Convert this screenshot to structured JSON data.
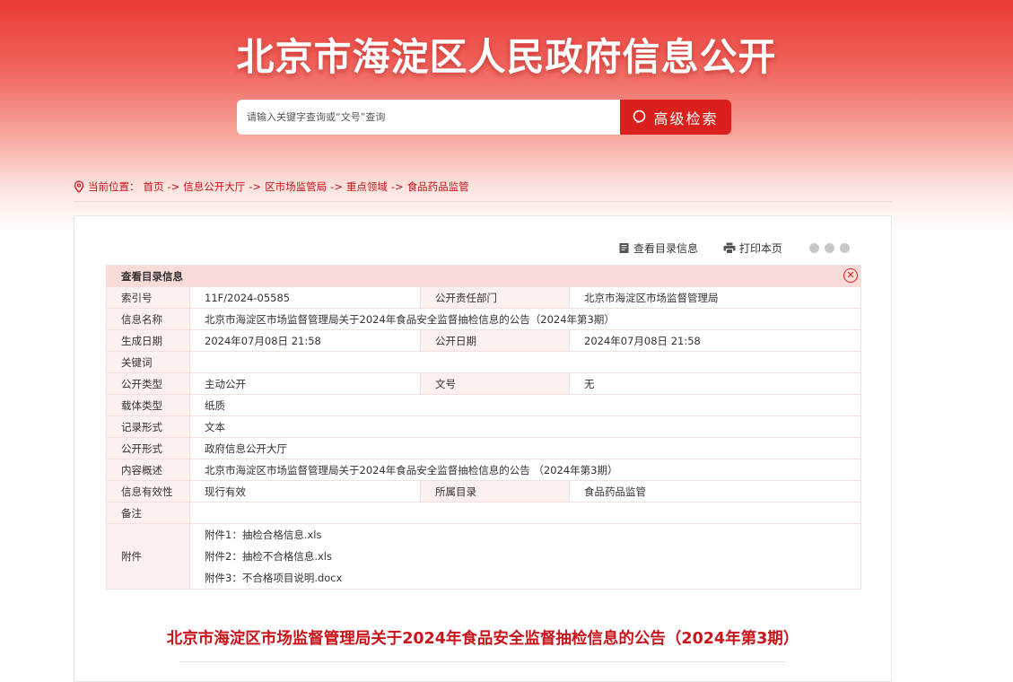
{
  "header": {
    "site_title": "北京市海淀区人民政府信息公开",
    "search_placeholder": "请输入关键字查询或“文号”查询",
    "search_button": "高级检索"
  },
  "breadcrumb": {
    "prefix": "当前位置：",
    "items": [
      "首页",
      "信息公开大厅",
      "区市场监管局",
      "重点领域",
      "食品药品监管"
    ],
    "separator": "->"
  },
  "tools": {
    "view_catalog": "查看目录信息",
    "print": "打印本页"
  },
  "catalog": {
    "title": "查看目录信息",
    "index_label": "索引号",
    "index_value": "11F/2024-05585",
    "dept_label": "公开责任部门",
    "dept_value": "北京市海淀区市场监督管理局",
    "name_label": "信息名称",
    "name_value": "北京市海淀区市场监督管理局关于2024年食品安全监督抽检信息的公告（2024年第3期）",
    "created_label": "生成日期",
    "created_value": "2024年07月08日 21:58",
    "published_label": "公开日期",
    "published_value": "2024年07月08日 21:58",
    "keywords_label": "关键词",
    "keywords_value": "",
    "open_type_label": "公开类型",
    "open_type_value": "主动公开",
    "doc_no_label": "文号",
    "doc_no_value": "无",
    "carrier_label": "载体类型",
    "carrier_value": "纸质",
    "record_label": "记录形式",
    "record_value": "文本",
    "form_label": "公开形式",
    "form_value": "政府信息公开大厅",
    "summary_label": "内容概述",
    "summary_value": "北京市海淀区市场监督管理局关于2024年食品安全监督抽检信息的公告 （2024年第3期）",
    "validity_label": "信息有效性",
    "validity_value": "现行有效",
    "category_label": "所属目录",
    "category_value": "食品药品监管",
    "remark_label": "备注",
    "remark_value": "",
    "attachments_label": "附件",
    "attachments": [
      "附件1：抽检合格信息.xls",
      "附件2：抽检不合格信息.xls",
      "附件3：不合格项目说明.docx"
    ]
  },
  "document": {
    "title": "北京市海淀区市场监督管理局关于2024年食品安全监督抽检信息的公告（2024年第3期）"
  },
  "colors": {
    "accent_red": "#d9201c",
    "title_red": "#c8141a",
    "table_label_bg": "#fdf1ef",
    "table_header_bg": "#f9dcd8"
  },
  "icons": [
    "search-icon",
    "location-pin-icon",
    "catalog-icon",
    "print-icon",
    "wechat-share-icon",
    "weibo-share-icon",
    "qzone-share-icon",
    "close-icon"
  ]
}
